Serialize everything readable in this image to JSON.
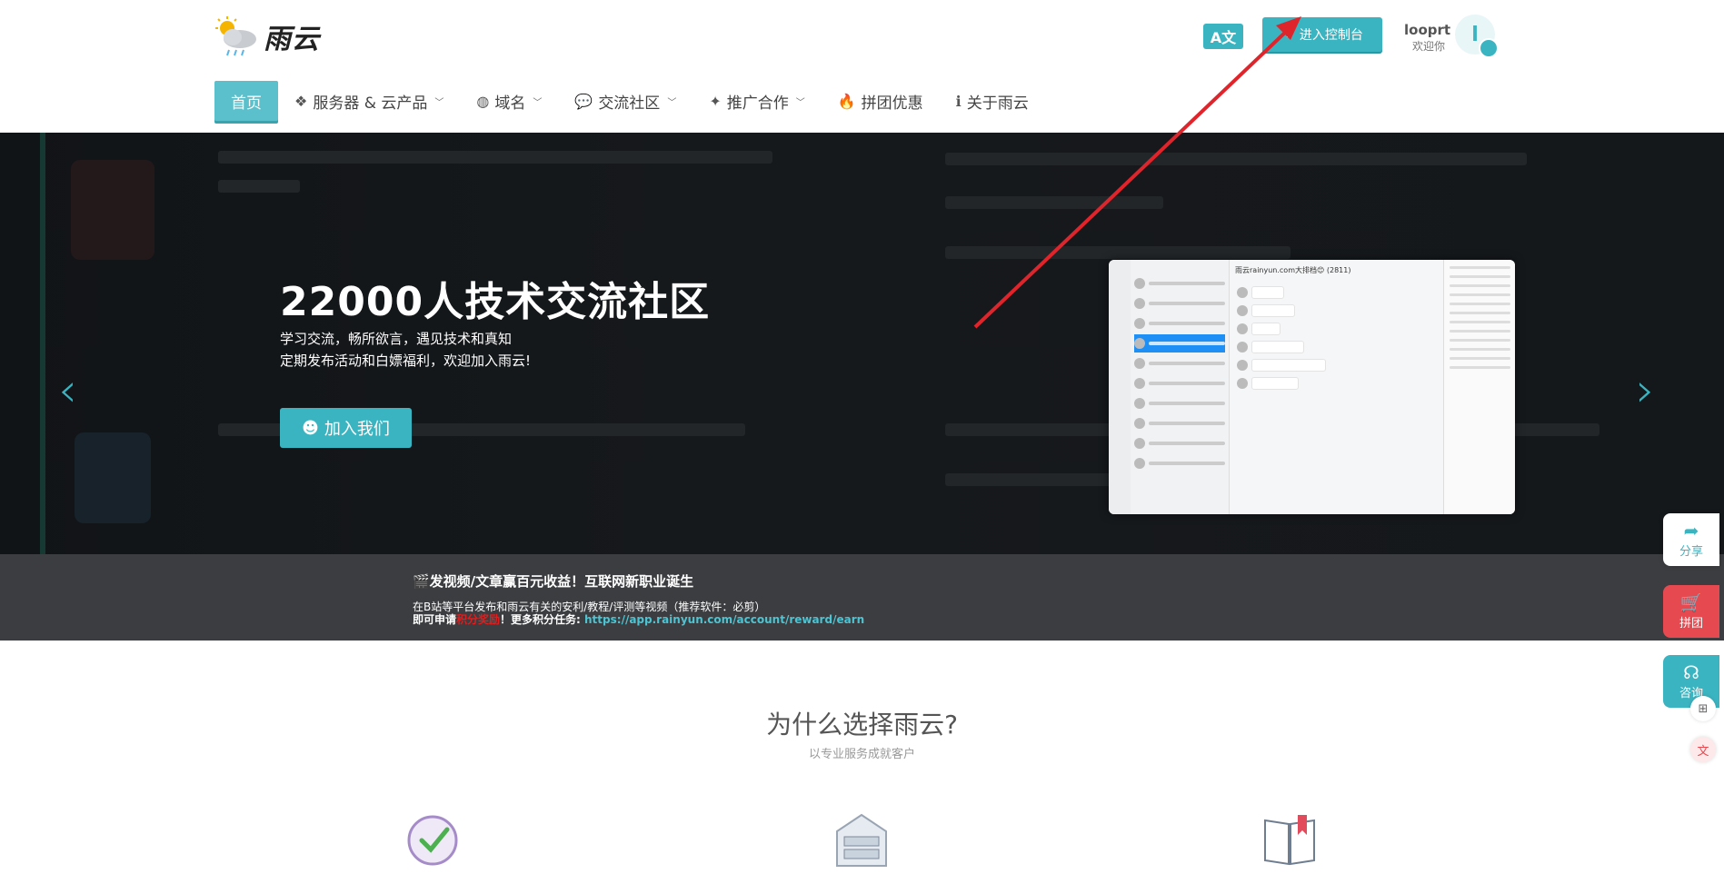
{
  "header": {
    "logo_text": "雨云",
    "translate_label": "A文",
    "console_button": "进入控制台",
    "user_name": "looprt",
    "user_greeting": "欢迎你",
    "avatar_letter": "l"
  },
  "nav": {
    "items": [
      {
        "label": "首页",
        "icon": "none"
      },
      {
        "label": "服务器 & 云产品",
        "icon": "cubes-icon",
        "dropdown": true
      },
      {
        "label": "域名",
        "icon": "globe-icon",
        "dropdown": true
      },
      {
        "label": "交流社区",
        "icon": "chat-icon",
        "dropdown": true
      },
      {
        "label": "推广合作",
        "icon": "sparkle-icon",
        "dropdown": true
      },
      {
        "label": "拼团优惠",
        "icon": "fire-icon"
      },
      {
        "label": "关于雨云",
        "icon": "info-icon"
      }
    ]
  },
  "hero": {
    "title": "22000人技术交流社区",
    "subtitle_1": "学习交流，畅所欲言，遇见技术和真知",
    "subtitle_2": "定期发布活动和白嫖福利，欢迎加入雨云!",
    "join_button": "加入我们",
    "chat_title": "雨云rainyun.com大排档😊 (2811)"
  },
  "banner": {
    "headline": "🎬发视频/文章赢百元收益！互联网新职业诞生",
    "line2": "在B站等平台发布和雨云有关的安利/教程/评测等视频（推荐软件：必剪）",
    "line3_prefix": "即可申请",
    "line3_red": "积分奖励",
    "line3_mid": "！更多积分任务: ",
    "line3_link": "https://app.rainyun.com/account/reward/earn"
  },
  "why": {
    "title": "为什么选择雨云?",
    "subtitle": "以专业服务成就客户"
  },
  "float": {
    "share": "分享",
    "group": "拼团",
    "consult": "咨询"
  },
  "colors": {
    "accent": "#3bb4c1",
    "red": "#e6494f",
    "annotation_arrow": "#e0242b"
  }
}
